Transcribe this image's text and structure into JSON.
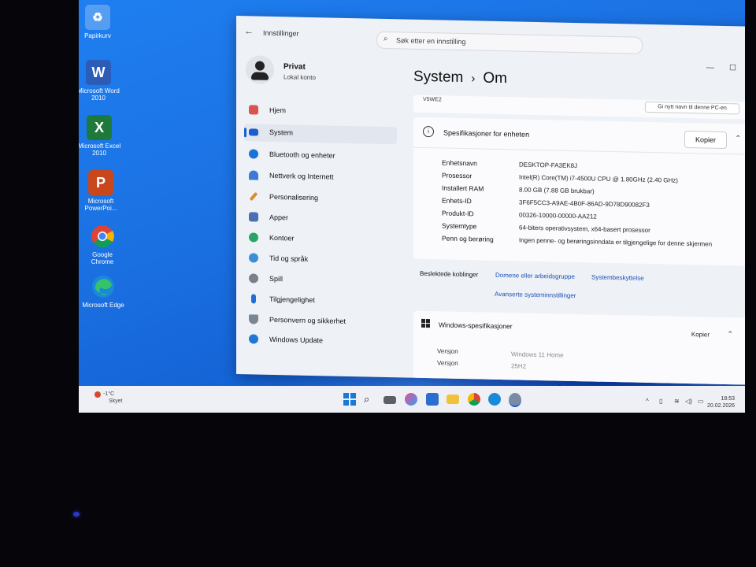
{
  "desktop": {
    "icons": [
      {
        "label": "Papirkurv",
        "icon": "recycle-bin-icon"
      },
      {
        "label": "Microsoft Word 2010",
        "icon": "word-icon",
        "glyph": "W",
        "color": "#2b5cb8"
      },
      {
        "label": "Microsoft Excel 2010",
        "icon": "excel-icon",
        "glyph": "X",
        "color": "#1e7a3c"
      },
      {
        "label": "Microsoft PowerPoi...",
        "icon": "powerpoint-icon",
        "glyph": "P",
        "color": "#c9471c"
      },
      {
        "label": "Google Chrome",
        "icon": "chrome-icon"
      },
      {
        "label": "Microsoft Edge",
        "icon": "edge-icon"
      }
    ]
  },
  "window": {
    "app_title": "Innstillinger",
    "search_placeholder": "Søk etter en innstilling",
    "user": {
      "name": "Privat",
      "account_type": "Lokal konto"
    },
    "nav": [
      {
        "label": "Hjem",
        "icon": "home-icon",
        "color": "#d9534f"
      },
      {
        "label": "System",
        "icon": "system-icon",
        "color": "#1a5fd0",
        "selected": true
      },
      {
        "label": "Bluetooth og enheter",
        "icon": "bluetooth-icon",
        "color": "#1a73d9"
      },
      {
        "label": "Nettverk og Internett",
        "icon": "wifi-icon",
        "color": "#3a7bd5"
      },
      {
        "label": "Personalisering",
        "icon": "brush-icon",
        "color": "#e08a2a"
      },
      {
        "label": "Apper",
        "icon": "apps-icon",
        "color": "#4b6fb5"
      },
      {
        "label": "Kontoer",
        "icon": "accounts-icon",
        "color": "#2aa36b"
      },
      {
        "label": "Tid og språk",
        "icon": "time-language-icon",
        "color": "#3b8fd6"
      },
      {
        "label": "Spill",
        "icon": "gaming-icon",
        "color": "#7a7f8a"
      },
      {
        "label": "Tilgjengelighet",
        "icon": "accessibility-icon",
        "color": "#1f6fd1"
      },
      {
        "label": "Personvern og sikkerhet",
        "icon": "shield-icon",
        "color": "#7a8694"
      },
      {
        "label": "Windows Update",
        "icon": "update-icon",
        "color": "#1f78d4"
      }
    ],
    "breadcrumb": {
      "parent": "System",
      "current": "Om"
    },
    "top_strip": {
      "text": "V5WE2",
      "button": "Gi nytt navn til denne PC-en"
    },
    "device_specs": {
      "title": "Spesifikasjoner for enheten",
      "copy": "Kopier",
      "rows": [
        {
          "label": "Enhetsnavn",
          "value": "DESKTOP-FA3EK8J"
        },
        {
          "label": "Prosessor",
          "value": "Intel(R) Core(TM) i7-4500U CPU @ 1.80GHz (2.40 GHz)"
        },
        {
          "label": "Installert RAM",
          "value": "8.00 GB (7.88 GB brukbar)"
        },
        {
          "label": "Enhets-ID",
          "value": "3F6F5CC3-A9AE-4B0F-86AD-9D78D90082F3"
        },
        {
          "label": "Produkt-ID",
          "value": "00326-10000-00000-AA212"
        },
        {
          "label": "Systemtype",
          "value": "64-biters operativsystem, x64-basert prosessor"
        },
        {
          "label": "Penn og berøring",
          "value": "Ingen penne- og berøringsinndata er tilgjengelige for denne skjermen"
        }
      ]
    },
    "related": {
      "label": "Beslektede koblinger",
      "links": [
        "Domene eller arbeidsgruppe",
        "Systembeskyttelse",
        "Avanserte systeminnstillinger"
      ]
    },
    "windows_specs": {
      "title": "Windows-spesifikasjoner",
      "copy": "Kopier",
      "rows": [
        {
          "label": "Versjon",
          "value": "Windows 11 Home"
        },
        {
          "label": "Versjon",
          "value": "25H2"
        }
      ]
    }
  },
  "taskbar": {
    "weather": {
      "temp": "-1°C",
      "condition": "Skyet"
    },
    "time": "18:53",
    "date": "20.02.2026"
  }
}
